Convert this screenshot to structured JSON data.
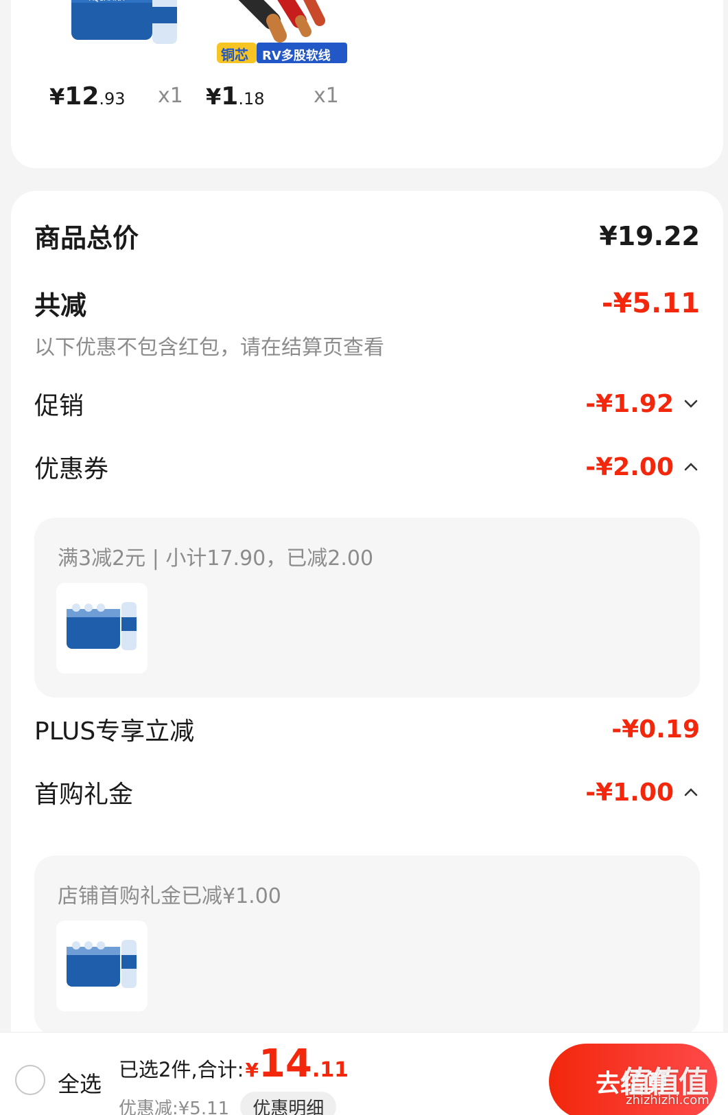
{
  "top_items": [
    {
      "name": "aquafina-water-pack",
      "price_int": "12",
      "price_dec": ".93",
      "qty": "x1"
    },
    {
      "name": "copper-wire",
      "price_int": "1",
      "price_dec": ".18",
      "qty": "x1",
      "image_labels": [
        "铜芯",
        "RV多股软线"
      ]
    }
  ],
  "currency": "¥",
  "summary": {
    "total_label": "商品总价",
    "total_value": "¥19.22",
    "reduce_label": "共减",
    "reduce_value": "-¥5.11",
    "hint": "以下优惠不包含红包，请在结算页查看",
    "promo_label": "促销",
    "promo_value": "-¥1.92",
    "coupon_label": "优惠券",
    "coupon_value": "-¥2.00",
    "coupon_detail": "满3减2元 | 小计17.90，已减2.00",
    "plus_label": "PLUS专享立减",
    "plus_value": "-¥0.19",
    "gift_label": "首购礼金",
    "gift_value": "-¥1.00",
    "gift_detail": "店铺首购礼金已减¥1.00"
  },
  "bottom_bar": {
    "select_all": "全选",
    "selected_text": "已选2件,合计:",
    "total_yen": "¥",
    "total_int": "14",
    "total_dec": ".11",
    "discount_text": "优惠减:¥5.11",
    "detail_button": "优惠明细",
    "checkout_button": "去结算"
  },
  "watermark": {
    "main": "值值值",
    "sub": "zhizhizhi.com"
  },
  "colors": {
    "accent": "#f2270c",
    "muted": "#8c8c8c"
  }
}
